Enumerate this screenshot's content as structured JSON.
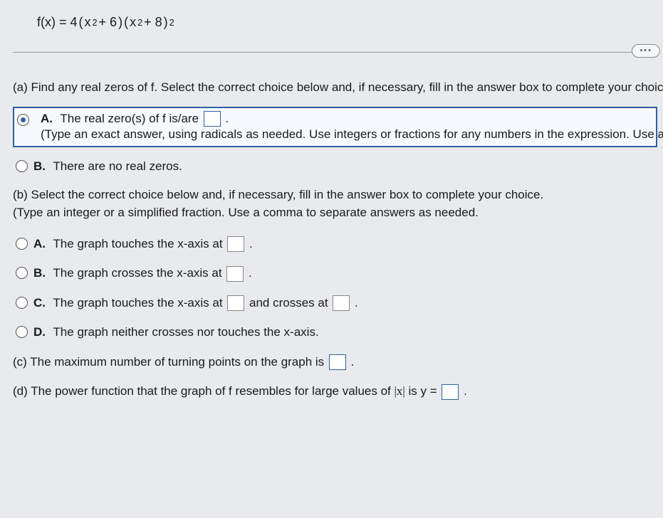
{
  "formula": {
    "lhs": "f(x) = 4",
    "open1": "(",
    "term1a": "x",
    "exp1": "2",
    "plus1": " + 6",
    "close1": ")",
    "open2": " (",
    "term2a": "x",
    "exp2": "2",
    "plus2": " + 8",
    "close2": ")",
    "outerExp": "2"
  },
  "badge": "•••",
  "qa": {
    "prompt": "(a) Find any real zeros of f. Select the correct choice below and, if necessary, fill in the answer box to complete your choice.",
    "A": {
      "letter": "A.",
      "line1a": "The real zero(s) of f is/are ",
      "period": ".",
      "line2": "(Type an exact answer, using radicals as needed. Use integers or fractions for any numbers in the expression. Use a comma to separate answers as needed.)"
    },
    "B": {
      "letter": "B.",
      "text": "There are no real zeros."
    }
  },
  "qb": {
    "prompt1": "(b) Select the correct choice below and, if necessary, fill in the answer box to complete your choice.",
    "prompt2": "(Type an integer or a simplified fraction. Use a comma to separate answers as needed.",
    "A": {
      "letter": "A.",
      "text": "The graph touches the x-axis at ",
      "period": "."
    },
    "B": {
      "letter": "B.",
      "text": "The graph crosses the x-axis at ",
      "period": "."
    },
    "C": {
      "letter": "C.",
      "text1": "The graph touches the x-axis at ",
      "mid": " and crosses at ",
      "period": "."
    },
    "D": {
      "letter": "D.",
      "text": "The graph neither crosses nor touches the x-axis."
    }
  },
  "qc": {
    "text": "(c) The maximum number of turning points on the graph is ",
    "period": "."
  },
  "qd": {
    "text1": "(d) The power function that the graph of f resembles for large values of ",
    "abs": "|x|",
    "text2": " is y = ",
    "period": "."
  }
}
